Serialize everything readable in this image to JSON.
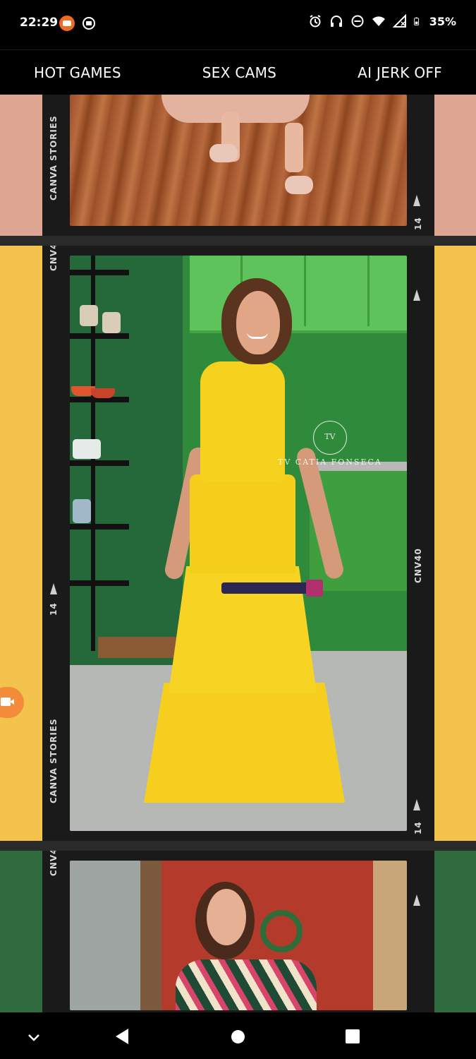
{
  "status_bar": {
    "time": "22:29",
    "battery": "35%",
    "icons": [
      "screen-recorder-icon",
      "cast-icon",
      "alarm-icon",
      "headphones-icon",
      "do-not-disturb-icon",
      "wifi-icon",
      "signal-icon",
      "battery-icon"
    ]
  },
  "nav": {
    "items": [
      {
        "label": "HOT GAMES"
      },
      {
        "label": "SEX CAMS"
      },
      {
        "label": "AI JERK OFF"
      }
    ]
  },
  "film": {
    "stories_label": "CANVA STORIES",
    "frame_number": "14",
    "code_short": "CNV4",
    "code_full": "CNV40"
  },
  "panels": [
    {
      "side_color": "#dfa593",
      "scene": "feet-on-wooden-floor"
    },
    {
      "side_color": "#f3c34b",
      "scene": "woman-in-yellow-dress-in-green-kitchen",
      "watermark_monogram": "TV",
      "watermark": "TV CATIA FONSECA"
    },
    {
      "side_color": "#2f6b3f",
      "scene": "woman-in-patterned-shirt-by-red-door"
    }
  ],
  "floating_button": {
    "icon": "video-camera-icon",
    "color": "#f28c3a"
  },
  "system_nav": {
    "buttons": [
      "collapse",
      "back",
      "home",
      "recents"
    ]
  }
}
